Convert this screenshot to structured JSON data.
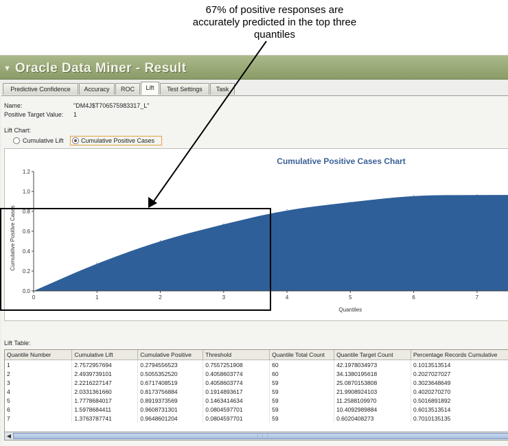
{
  "annotation": {
    "line1": "67% of positive responses are",
    "line2": "accurately predicted in the top three",
    "line3": "quantiles"
  },
  "window": {
    "title": "Oracle Data Miner - Result",
    "tabs": [
      "Predictive Confidence",
      "Accuracy",
      "ROC",
      "Lift",
      "Test Settings",
      "Task"
    ],
    "active_tab": "Lift"
  },
  "details": {
    "name_label": "Name:",
    "name_value": "\"DM4J$T706575983317_L\"",
    "target_label": "Positive Target Value:",
    "target_value": "1",
    "lift_chart_label": "Lift Chart:",
    "option_cumulative_lift": "Cumulative Lift",
    "option_cumulative_positive": "Cumulative Positive Cases",
    "selected_option": "Cumulative Positive Cases"
  },
  "chart_data": {
    "type": "area",
    "title": "Cumulative Positive Cases Chart",
    "xlabel": "Quantiles",
    "ylabel": "Cumulative Positive Cases",
    "x_ticks": [
      "0",
      "1",
      "2",
      "3",
      "4",
      "5",
      "6",
      "7"
    ],
    "y_ticks": [
      "0.0",
      "0.2",
      "0.4",
      "0.6",
      "0.8",
      "1.0",
      "1.2"
    ],
    "xlim": [
      0,
      7.5
    ],
    "ylim": [
      0,
      1.2
    ],
    "x": [
      0,
      1,
      2,
      3,
      4,
      5,
      6,
      7,
      7.5
    ],
    "values": [
      0,
      0.2795,
      0.5055,
      0.6717,
      0.8174,
      0.8919,
      0.9609,
      0.9649,
      0.9649
    ],
    "color": "#2e5f99",
    "grid": false
  },
  "table": {
    "label": "Lift Table:",
    "columns": [
      "Quantile Number",
      "Cumulative Lift",
      "Cumulative Positive",
      "Threshold",
      "Quantile Total Count",
      "Quantile Target Count",
      "Percentage Records Cumulative"
    ],
    "rows": [
      [
        "1",
        "2.7572957694",
        "0.2794556523",
        "0.7557251908",
        "60",
        "42.1978034973",
        "0.1013513514"
      ],
      [
        "2",
        "2.4939739101",
        "0.5055352520",
        "0.4058603774",
        "60",
        "34.1380195618",
        "0.2027027027"
      ],
      [
        "3",
        "2.2216227147",
        "0.6717408519",
        "0.4058603774",
        "59",
        "25.0870153808",
        "0.3023648649"
      ],
      [
        "4",
        "2.0331361660",
        "0.8173756884",
        "0.1914893617",
        "59",
        "21.9908924103",
        "0.4020270270"
      ],
      [
        "5",
        "1.7778684017",
        "0.8919373569",
        "0.1463414634",
        "59",
        "11.2588109970",
        "0.5016891892"
      ],
      [
        "6",
        "1.5978684411",
        "0.9608731301",
        "0.0804597701",
        "59",
        "10.4092989884",
        "0.6013513514"
      ],
      [
        "7",
        "1.3763787741",
        "0.9648601204",
        "0.0804597701",
        "59",
        "0.6020408273",
        "0.7010135135"
      ]
    ]
  }
}
